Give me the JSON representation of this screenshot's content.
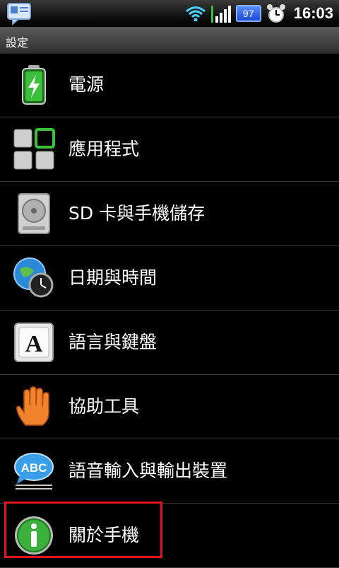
{
  "status": {
    "battery_level": "97",
    "time": "16:03"
  },
  "titlebar": {
    "title": "設定"
  },
  "items": [
    {
      "label": "電源",
      "icon": "battery-icon"
    },
    {
      "label": "應用程式",
      "icon": "apps-grid-icon"
    },
    {
      "label": "SD 卡與手機儲存",
      "icon": "storage-disk-icon"
    },
    {
      "label": "日期與時間",
      "icon": "globe-clock-icon"
    },
    {
      "label": "語言與鍵盤",
      "icon": "keyboard-key-icon"
    },
    {
      "label": "協助工具",
      "icon": "hand-icon"
    },
    {
      "label": "語音輸入與輸出裝置",
      "icon": "speech-bubble-icon"
    },
    {
      "label": "關於手機",
      "icon": "info-icon"
    }
  ],
  "colors": {
    "highlight": "#e0141e",
    "accent_green": "#3cc03c"
  }
}
